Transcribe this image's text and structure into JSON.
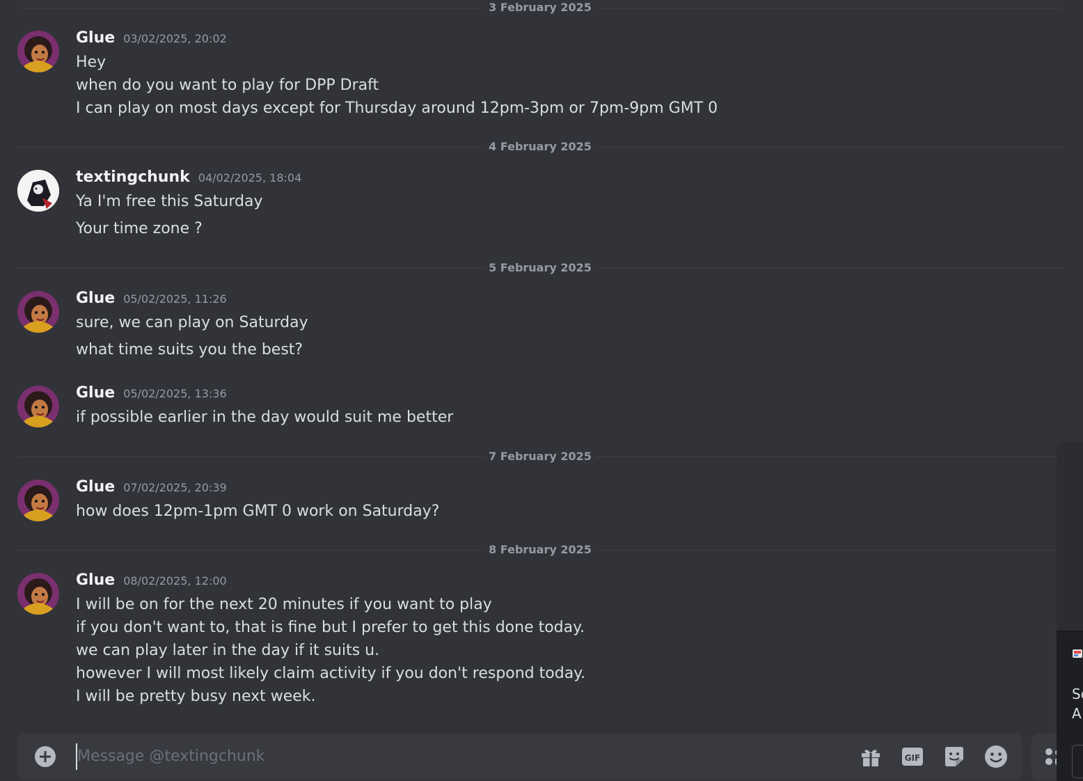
{
  "conversation": {
    "recipient": "textingchunk",
    "days": [
      {
        "date_label": "3 February 2025",
        "messages": [
          {
            "author": "Glue",
            "timestamp": "03/02/2025, 20:02",
            "lines": [
              "Hey",
              "when do you want to play for DPP Draft",
              "I can play on most days except for Thursday around 12pm-3pm or 7pm-9pm GMT 0"
            ]
          }
        ]
      },
      {
        "date_label": "4 February 2025",
        "messages": [
          {
            "author": "textingchunk",
            "timestamp": "04/02/2025, 18:04",
            "lines": [
              "Ya I'm free this Saturday",
              "Your time zone ?"
            ]
          }
        ]
      },
      {
        "date_label": "5 February 2025",
        "messages": [
          {
            "author": "Glue",
            "timestamp": "05/02/2025, 11:26",
            "lines": [
              "sure, we can play on Saturday",
              "what time suits you the best?"
            ]
          },
          {
            "author": "Glue",
            "timestamp": "05/02/2025, 13:36",
            "lines": [
              "if possible earlier in the day would suit me better"
            ]
          }
        ]
      },
      {
        "date_label": "7 February 2025",
        "messages": [
          {
            "author": "Glue",
            "timestamp": "07/02/2025, 20:39",
            "lines": [
              "how does 12pm-1pm GMT 0 work on Saturday?"
            ]
          }
        ]
      },
      {
        "date_label": "8 February 2025",
        "messages": [
          {
            "author": "Glue",
            "timestamp": "08/02/2025, 12:00",
            "lines": [
              "I will be on for the next 20 minutes if you want to play",
              "if you don't want to, that is fine but I prefer to get this done today.",
              "we can play later in the day if it suits u.",
              "however I will most likely claim activity if you don't respond today.",
              "I will be pretty busy next week."
            ]
          }
        ]
      }
    ]
  },
  "composer": {
    "placeholder": "Message @textingchunk",
    "tools": [
      {
        "name": "add-attachment",
        "icon": "plus-circle-icon"
      },
      {
        "name": "gift",
        "icon": "gift-icon"
      },
      {
        "name": "gif",
        "icon": "gif-icon",
        "label": "GIF"
      },
      {
        "name": "sticker",
        "icon": "sticker-icon"
      },
      {
        "name": "emoji",
        "icon": "emoji-icon"
      },
      {
        "name": "apps",
        "icon": "apps-icon"
      }
    ]
  },
  "side_popup": {
    "line1": "Sc",
    "line2": "A"
  },
  "colors": {
    "background": "#313338",
    "composer": "#383a40",
    "text": "#dbdee1",
    "muted": "#949ba4"
  }
}
